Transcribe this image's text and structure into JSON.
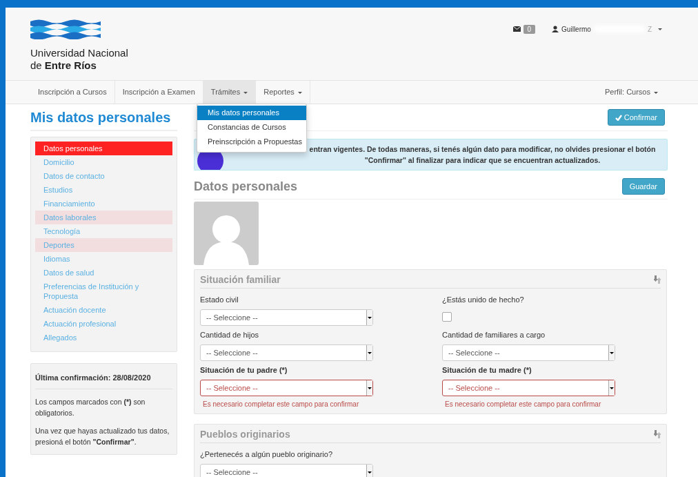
{
  "header": {
    "logo_line1": "Universidad Nacional",
    "logo_line2": "de **Entre Ríos**",
    "messages_count": "0",
    "user_name": "Guillermo",
    "user_suffix": "Z"
  },
  "nav": {
    "items": [
      {
        "label": "Inscripción a Cursos",
        "selected": false,
        "dropdown": false
      },
      {
        "label": "Inscripción a Examen",
        "selected": false,
        "dropdown": false
      },
      {
        "label": "Trámites",
        "selected": true,
        "dropdown": true
      },
      {
        "label": "Reportes",
        "selected": false,
        "dropdown": true
      }
    ],
    "profile": "Perfil: Cursos"
  },
  "menu": {
    "items": [
      {
        "label": "Mis datos personales",
        "selected": true
      },
      {
        "label": "Constancias de Cursos",
        "selected": false
      },
      {
        "label": "Preinscripción a Propuestas",
        "selected": false
      }
    ]
  },
  "page_title": "Mis datos personales",
  "confirm_button": "Confirmar",
  "sidebar": {
    "items": [
      {
        "label": "Datos personales",
        "selected": true,
        "flagged": false
      },
      {
        "label": "Domicilio",
        "selected": false,
        "flagged": false
      },
      {
        "label": "Datos de contacto",
        "selected": false,
        "flagged": false
      },
      {
        "label": "Estudios",
        "selected": false,
        "flagged": false
      },
      {
        "label": "Financiamiento",
        "selected": false,
        "flagged": false
      },
      {
        "label": "Datos laborales",
        "selected": false,
        "flagged": true
      },
      {
        "label": "Tecnología",
        "selected": false,
        "flagged": false
      },
      {
        "label": "Deportes",
        "selected": false,
        "flagged": true
      },
      {
        "label": "Idiomas",
        "selected": false,
        "flagged": false
      },
      {
        "label": "Datos de salud",
        "selected": false,
        "flagged": false
      },
      {
        "label": "Preferencias de Institución y Propuesta",
        "selected": false,
        "flagged": false
      },
      {
        "label": "Actuación docente",
        "selected": false,
        "flagged": false
      },
      {
        "label": "Actuación profesional",
        "selected": false,
        "flagged": false
      },
      {
        "label": "Allegados",
        "selected": false,
        "flagged": false
      }
    ]
  },
  "info_panel": {
    "title": "Última confirmación: 28/08/2020",
    "paragraphs": [
      "Los campos marcados con **(*)** son obligatorios.",
      "Una vez que hayas actualizado tus datos, presioná el botón **\"Confirmar\"**."
    ]
  },
  "alert": {
    "lines": [
      "entran vigentes. De todas maneras, si tenés algún dato para modificar, no olvides presionar el botón",
      "\"Confirmar\" al finalizar para indicar que se encuentran actualizados."
    ]
  },
  "section_title": "Datos personales",
  "save_button": "Guardar",
  "panels": [
    {
      "title": "Situación familiar",
      "fields": [
        {
          "kind": "select",
          "label": "Estado civil",
          "required": false,
          "value": "-- Seleccione --"
        },
        {
          "kind": "checkbox",
          "label": "¿Estás unido de hecho?",
          "required": false,
          "checked": false
        },
        {
          "kind": "select",
          "label": "Cantidad de hijos",
          "required": false,
          "value": "-- Seleccione --"
        },
        {
          "kind": "select",
          "label": "Cantidad de familiares a cargo",
          "required": false,
          "value": "-- Seleccione --"
        },
        {
          "kind": "select",
          "label": "Situación de tu padre (*)",
          "required": true,
          "value": "-- Seleccione --",
          "error": "Es necesario completar este campo para confirmar"
        },
        {
          "kind": "select",
          "label": "Situación de tu madre (*)",
          "required": true,
          "value": "-- Seleccione --",
          "error": "Es necesario completar este campo para confirmar"
        }
      ]
    },
    {
      "title": "Pueblos originarios",
      "fields": [
        {
          "kind": "select",
          "label": "¿Pertenecés a algún pueblo originario?",
          "required": false,
          "value": "-- Seleccione --"
        }
      ]
    }
  ]
}
